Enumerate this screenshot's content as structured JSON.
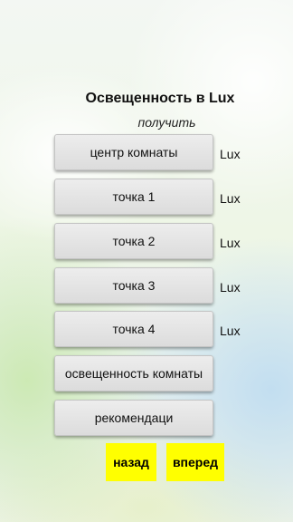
{
  "title": "Освещенность в Lux",
  "subtitle": "получить",
  "unit": "Lux",
  "buttons": {
    "center": "центр комнаты",
    "point1": "точка 1",
    "point2": "точка 2",
    "point3": "точка 3",
    "point4": "точка 4",
    "room": "освещенность комнаты",
    "recommend": "рекомендаци"
  },
  "nav": {
    "back": "назад",
    "forward": "вперед"
  },
  "colors": {
    "nav_bg": "#ffff00",
    "button_bg": "#e3e3e3"
  }
}
